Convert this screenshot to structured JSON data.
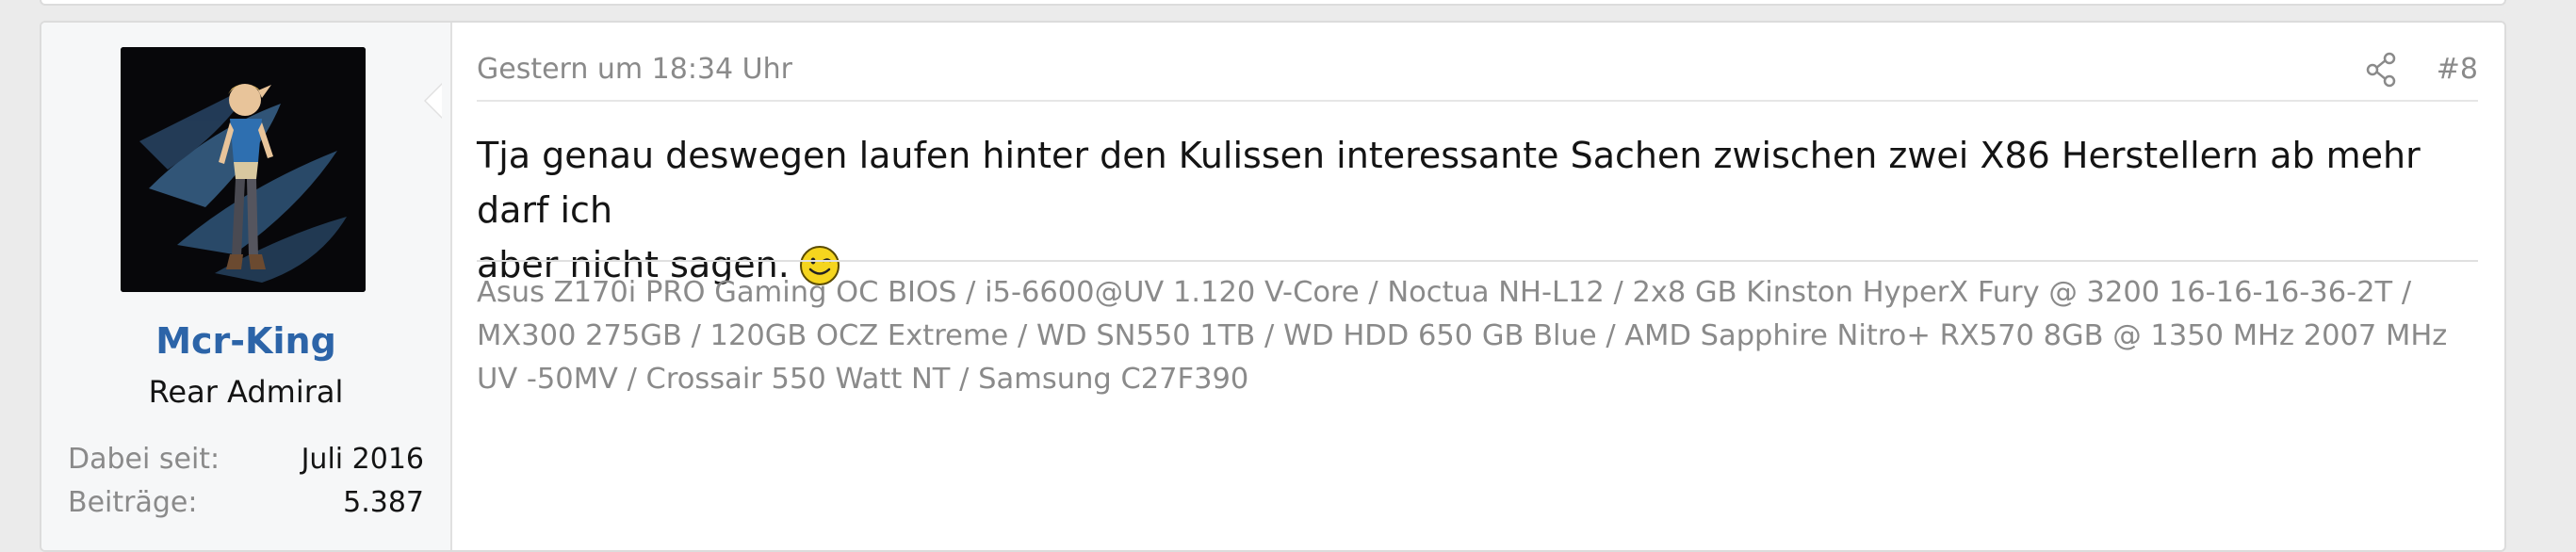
{
  "post": {
    "user": {
      "name": "Mcr-King",
      "title": "Rear Admiral",
      "stats": [
        {
          "label": "Dabei seit:",
          "value": "Juli 2016"
        },
        {
          "label": "Beiträge:",
          "value": "5.387"
        }
      ]
    },
    "date": "Gestern um 18:34 Uhr",
    "number": "#8",
    "message_line1": "Tja genau deswegen laufen hinter den Kulissen interessante Sachen zwischen zwei X86 Herstellern ab mehr darf ich",
    "message_line2": "aber nicht sagen.",
    "signature": "Asus Z170i PRO Gaming OC BIOS / i5-6600@UV 1.120 V-Core / Noctua NH-L12 / 2x8 GB Kinston HyperX Fury @ 3200 16-16-16-36-2T / MX300 275GB / 120GB OCZ Extreme / WD SN550 1TB / WD HDD 650 GB Blue / AMD Sapphire Nitro+ RX570 8GB @ 1350 MHz 2007 MHz UV -50MV / Crossair 550 Watt NT / Samsung C27F390",
    "icons": {
      "share": "share-icon",
      "smiley": "wink-smiley-icon"
    },
    "colors": {
      "username": "#2c64a8",
      "muted": "#8a8a8a",
      "text": "#141414",
      "sidebar_bg": "#f6f7f8",
      "page_bg": "#ebebeb"
    }
  }
}
